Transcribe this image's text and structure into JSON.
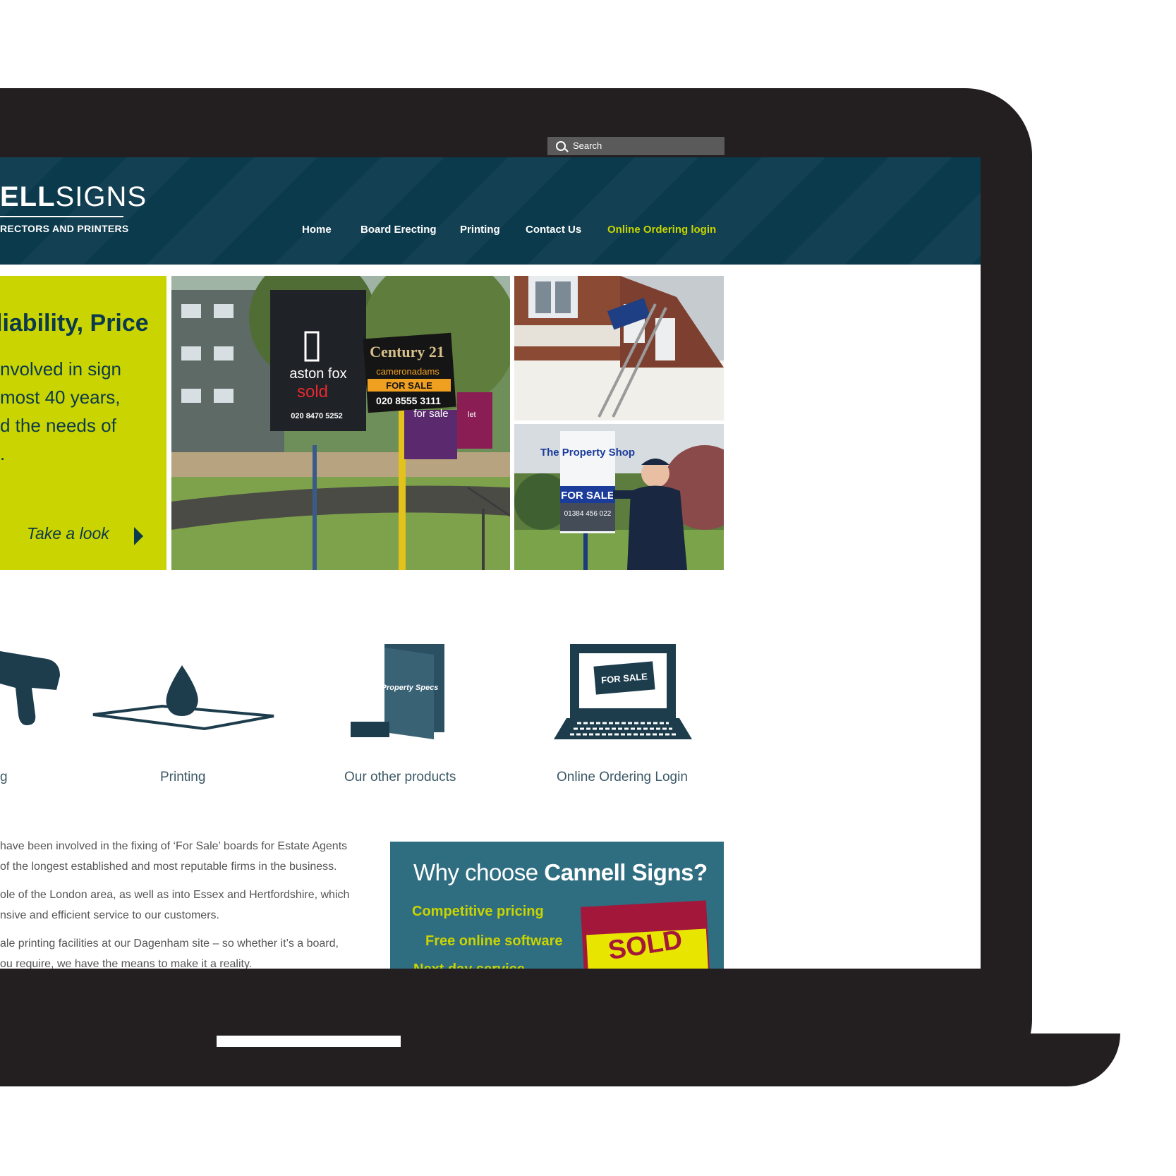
{
  "search": {
    "placeholder": "Search"
  },
  "logo": {
    "line1_bold": "ELL",
    "line1_rest": "SIGNS",
    "line2": "RECTORS AND PRINTERS"
  },
  "nav": {
    "home": "Home",
    "board_erecting": "Board Erecting",
    "printing": "Printing",
    "contact": "Contact Us",
    "online_ordering": "Online Ordering login"
  },
  "hero": {
    "title": "liability, Price",
    "body_lines": [
      "nvolved in sign",
      "most 40 years,",
      "d the needs of",
      "."
    ],
    "cta": "Take a look"
  },
  "photos": {
    "sign1_brand": "aston fox",
    "sign1_status": "sold",
    "sign1_phone": "020 8470 5252",
    "sign2_brand": "Century 21",
    "sign2_sub": "cameronadams",
    "sign2_status": "FOR SALE",
    "sign2_phone": "020 8555 3111",
    "sign3": "for sale",
    "sign4": "let",
    "sign5_brand": "The Property Shop",
    "sign5_status": "FOR SALE",
    "sign5_phone": "01384 456 022"
  },
  "services": {
    "s1": "g",
    "s2": "Printing",
    "s3": "Our other products",
    "s4": "Online Ordering Login",
    "folder_text": "Property Specs",
    "screen_text": "FOR SALE"
  },
  "about": {
    "lines": [
      "have been involved in the fixing of ‘For Sale’ boards for Estate Agents",
      " of the longest established and most reputable firms in the business.",
      "ole of the London area, as well as into Essex and Hertfordshire, which",
      "nsive and efficient service to our customers.",
      "ale printing facilities at our Dagenham site – so whether it’s a board,",
      "ou require, we have the means to make it a reality."
    ]
  },
  "why": {
    "title_a": "Why choose ",
    "title_b": "Cannell Signs?",
    "point1": "Competitive pricing",
    "point2": "Free online software",
    "point3": "Next day service",
    "sold": "SOLD"
  },
  "colors": {
    "navy": "#0b3a4c",
    "lime": "#c9d400",
    "teal": "#2f6d80",
    "bezel": "#231f20"
  }
}
